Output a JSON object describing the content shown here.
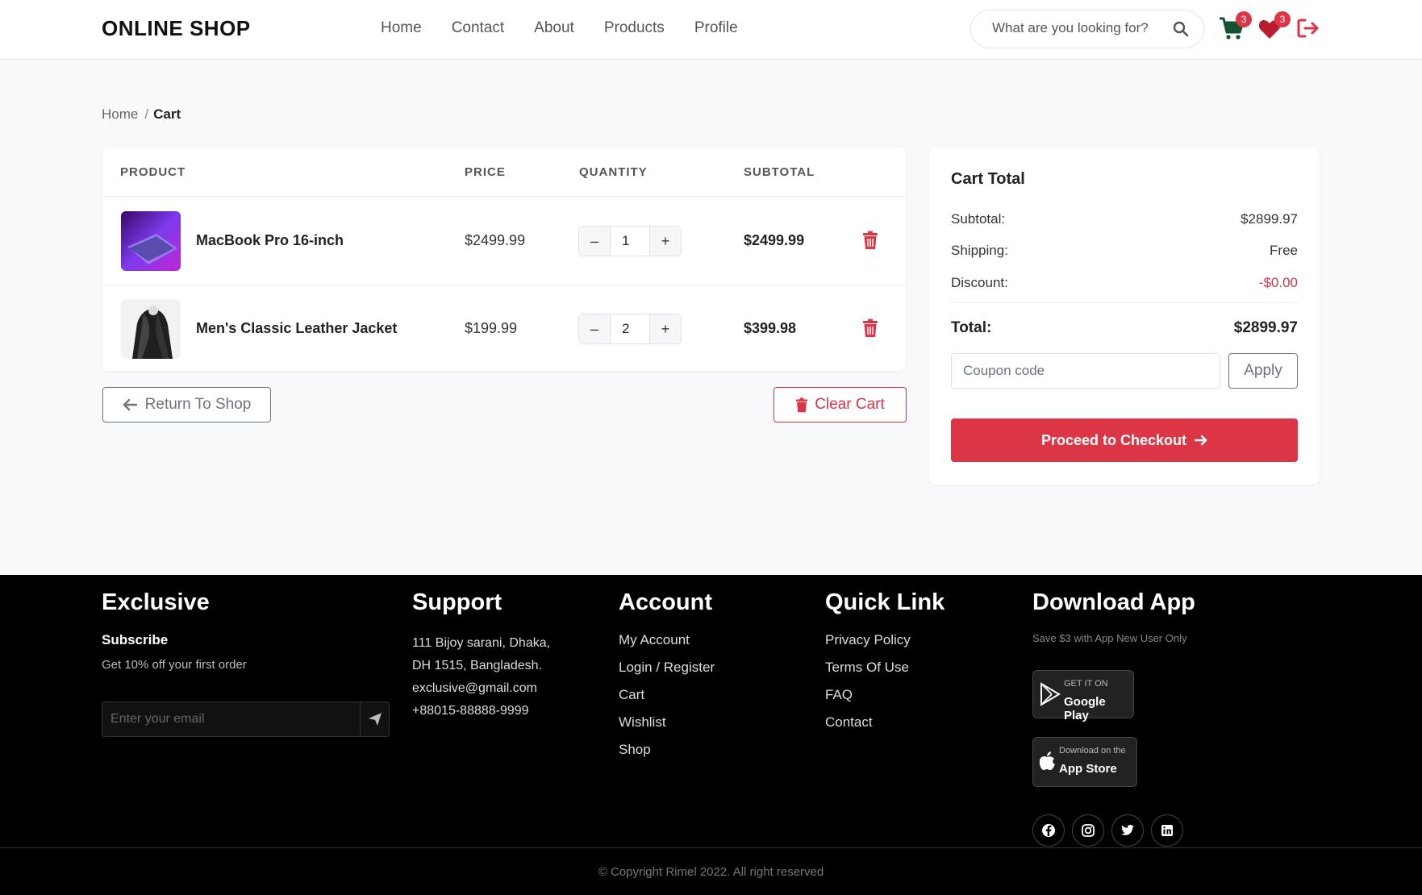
{
  "header": {
    "brand": "ONLINE SHOP",
    "nav": [
      "Home",
      "Contact",
      "About",
      "Products",
      "Profile"
    ],
    "search_placeholder": "What are you looking for?",
    "cart_count": "3",
    "wishlist_count": "3"
  },
  "breadcrumb": {
    "home": "Home",
    "separator": "/",
    "current": "Cart"
  },
  "cart": {
    "headers": {
      "product": "PRODUCT",
      "price": "PRICE",
      "quantity": "QUANTITY",
      "subtotal": "SUBTOTAL"
    },
    "items": [
      {
        "name": "MacBook Pro 16-inch",
        "price": "$2499.99",
        "qty": "1",
        "subtotal": "$2499.99",
        "minus": "–",
        "plus": "+"
      },
      {
        "name": "Men's Classic Leather Jacket",
        "price": "$199.99",
        "qty": "2",
        "subtotal": "$399.98",
        "minus": "–",
        "plus": "+"
      }
    ],
    "return_label": "Return To Shop",
    "clear_label": "Clear Cart"
  },
  "cart_total": {
    "title": "Cart Total",
    "subtotal_label": "Subtotal:",
    "subtotal": "$2899.97",
    "shipping_label": "Shipping:",
    "shipping": "Free",
    "discount_label": "Discount:",
    "discount": "-$0.00",
    "total_label": "Total:",
    "total": "$2899.97",
    "coupon_placeholder": "Coupon code",
    "apply_label": "Apply",
    "checkout_label": "Proceed to Checkout"
  },
  "footer": {
    "exclusive": {
      "title": "Exclusive",
      "subscribe": "Subscribe",
      "offer": "Get 10% off your first order",
      "email_placeholder": "Enter your email"
    },
    "support": {
      "title": "Support",
      "lines": [
        "111 Bijoy sarani, Dhaka,",
        "DH 1515, Bangladesh.",
        "exclusive@gmail.com",
        "+88015-88888-9999"
      ]
    },
    "account": {
      "title": "Account",
      "links": [
        "My Account",
        "Login / Register",
        "Cart",
        "Wishlist",
        "Shop"
      ]
    },
    "quick_link": {
      "title": "Quick Link",
      "links": [
        "Privacy Policy",
        "Terms Of Use",
        "FAQ",
        "Contact"
      ]
    },
    "download": {
      "title": "Download App",
      "note": "Save $3 with App New User Only",
      "google_small": "GET IT ON",
      "google_big": "Google Play",
      "apple_small": "Download on the",
      "apple_big": "App Store"
    },
    "copyright": "© Copyright Rimel 2022. All right reserved"
  },
  "colors": {
    "accent": "#dc3545",
    "footer_bg": "#000000",
    "cart_icon": "#14532d"
  },
  "icons": [
    "search-icon",
    "cart-icon",
    "heart-icon",
    "logout-icon",
    "trash-icon",
    "arrow-left-icon",
    "arrow-right-icon",
    "send-icon",
    "google-play-icon",
    "apple-icon",
    "facebook-icon",
    "instagram-icon",
    "twitter-icon",
    "linkedin-icon"
  ]
}
